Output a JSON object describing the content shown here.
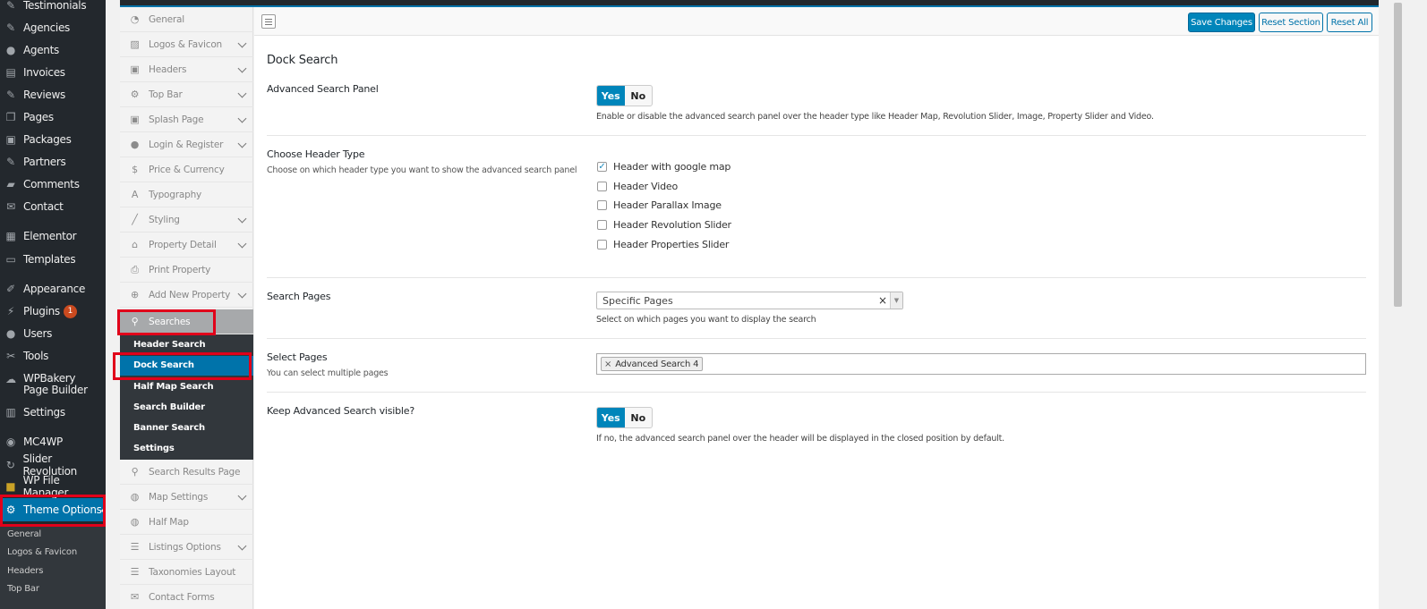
{
  "wp_menu": {
    "items": [
      {
        "label": "Testimonials",
        "icon": "pin-icon"
      },
      {
        "label": "Agencies",
        "icon": "pin-icon"
      },
      {
        "label": "Agents",
        "icon": "user-icon"
      },
      {
        "label": "Invoices",
        "icon": "document-icon"
      },
      {
        "label": "Reviews",
        "icon": "pin-icon"
      },
      {
        "label": "Pages",
        "icon": "pages-icon"
      },
      {
        "label": "Packages",
        "icon": "package-icon"
      },
      {
        "label": "Partners",
        "icon": "pin-icon"
      },
      {
        "label": "Comments",
        "icon": "comment-icon"
      },
      {
        "label": "Contact",
        "icon": "mail-icon"
      },
      {
        "label": "Elementor",
        "icon": "elementor-icon"
      },
      {
        "label": "Templates",
        "icon": "folder-icon"
      },
      {
        "label": "Appearance",
        "icon": "brush-icon"
      },
      {
        "label": "Plugins",
        "icon": "plugin-icon",
        "badge": "1"
      },
      {
        "label": "Users",
        "icon": "user-icon"
      },
      {
        "label": "Tools",
        "icon": "wrench-icon"
      },
      {
        "label": "WPBakery Page Builder",
        "icon": "cloud-icon"
      },
      {
        "label": "Settings",
        "icon": "settings-icon"
      },
      {
        "label": "MC4WP",
        "icon": "mc4wp-icon"
      },
      {
        "label": "Slider Revolution",
        "icon": "refresh-icon"
      },
      {
        "label": "WP File Manager",
        "icon": "folder-icon"
      },
      {
        "label": "Theme Options",
        "icon": "gear-icon"
      }
    ],
    "sub_items": [
      "General",
      "Logos & Favicon",
      "Headers",
      "Top Bar"
    ]
  },
  "options_nav": {
    "items": [
      {
        "label": "General",
        "icon": "dashboard-icon"
      },
      {
        "label": "Logos & Favicon",
        "icon": "image-icon"
      },
      {
        "label": "Headers",
        "icon": "header-icon"
      },
      {
        "label": "Top Bar",
        "icon": "gear-icon"
      },
      {
        "label": "Splash Page",
        "icon": "image-icon"
      },
      {
        "label": "Login & Register",
        "icon": "lock-icon"
      },
      {
        "label": "Price & Currency",
        "icon": "dollar-icon"
      },
      {
        "label": "Typography",
        "icon": "typography-icon"
      },
      {
        "label": "Styling",
        "icon": "brush-icon"
      },
      {
        "label": "Property Detail",
        "icon": "home-icon"
      },
      {
        "label": "Print Property",
        "icon": "print-icon"
      },
      {
        "label": "Add New Property",
        "icon": "plus-circle-icon"
      },
      {
        "label": "Searches",
        "icon": "search-icon"
      }
    ],
    "sub_items": [
      "Header Search",
      "Dock Search",
      "Half Map Search",
      "Search Builder",
      "Banner Search",
      "Settings"
    ],
    "items_after": [
      {
        "label": "Search Results Page",
        "icon": "search-icon"
      },
      {
        "label": "Map Settings",
        "icon": "globe-icon"
      },
      {
        "label": "Half Map",
        "icon": "globe-icon"
      },
      {
        "label": "Listings Options",
        "icon": "list-icon"
      },
      {
        "label": "Taxonomies Layout",
        "icon": "list-icon"
      },
      {
        "label": "Contact Forms",
        "icon": "mail-icon"
      }
    ]
  },
  "toolbar": {
    "save_label": "Save Changes",
    "reset_section_label": "Reset Section",
    "reset_all_label": "Reset All"
  },
  "section": {
    "title": "Dock Search",
    "advanced_panel": {
      "title": "Advanced Search Panel",
      "yes": "Yes",
      "no": "No",
      "description": "Enable or disable the advanced search panel over the header type like Header Map, Revolution Slider, Image, Property Slider and Video."
    },
    "header_type": {
      "title": "Choose Header Type",
      "subtitle": "Choose on which header type you want to show the advanced search panel",
      "options": [
        {
          "label": "Header with google map",
          "checked": true
        },
        {
          "label": "Header Video",
          "checked": false
        },
        {
          "label": "Header Parallax Image",
          "checked": false
        },
        {
          "label": "Header Revolution Slider",
          "checked": false
        },
        {
          "label": "Header Properties Slider",
          "checked": false
        }
      ]
    },
    "search_pages": {
      "title": "Search Pages",
      "selected": "Specific Pages",
      "description": "Select on which pages you want to display the search"
    },
    "select_pages": {
      "title": "Select Pages",
      "subtitle": "You can select multiple pages",
      "tags": [
        "Advanced Search 4"
      ]
    },
    "keep_visible": {
      "title": "Keep Advanced Search visible?",
      "yes": "Yes",
      "no": "No",
      "description": "If no, the advanced search panel over the header will be displayed in the closed position by default."
    }
  },
  "colors": {
    "wp_sidebar": "#23282d",
    "accent": "#0073aa",
    "highlight": "#e1001a",
    "badge": "#ca4a1f"
  }
}
